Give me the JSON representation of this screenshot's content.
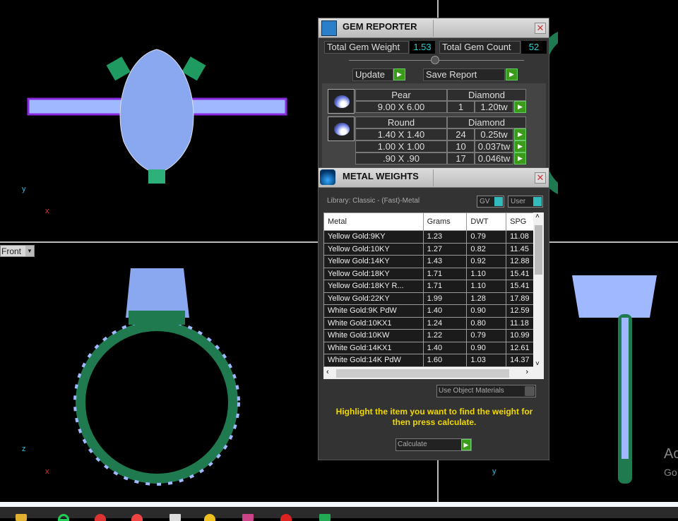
{
  "viewports": {
    "front_label": "Front",
    "axes": {
      "top_left": [
        "y",
        "x"
      ],
      "bottom_left": [
        "z",
        "x"
      ],
      "bottom_right": [
        "y"
      ]
    }
  },
  "gem_reporter": {
    "title": "GEM REPORTER",
    "total_weight_label": "Total Gem Weight",
    "total_weight": "1.53",
    "total_count_label": "Total Gem Count",
    "total_count": "52",
    "update_label": "Update",
    "save_label": "Save Report",
    "groups": [
      {
        "shape": "Pear",
        "material": "Diamond",
        "rows": [
          {
            "size": "9.00 X 6.00",
            "count": "1",
            "weight": "1.20tw"
          }
        ]
      },
      {
        "shape": "Round",
        "material": "Diamond",
        "rows": [
          {
            "size": "1.40 X 1.40",
            "count": "24",
            "weight": "0.25tw"
          },
          {
            "size": "1.00 X 1.00",
            "count": "10",
            "weight": "0.037tw"
          },
          {
            "size": ".90 X .90",
            "count": "17",
            "weight": "0.046tw"
          }
        ]
      }
    ]
  },
  "metal_weights": {
    "title": "METAL WEIGHTS",
    "library": "Library: Classic - (Fast)-Metal",
    "gv_label": "GV",
    "user_label": "User",
    "columns": [
      "Metal",
      "Grams",
      "DWT",
      "SPG"
    ],
    "rows": [
      [
        "Yellow Gold:9KY",
        "1.23",
        "0.79",
        "11.08"
      ],
      [
        "Yellow Gold:10KY",
        "1.27",
        "0.82",
        "11.45"
      ],
      [
        "Yellow Gold:14KY",
        "1.43",
        "0.92",
        "12.88"
      ],
      [
        "Yellow Gold:18KY",
        "1.71",
        "1.10",
        "15.41"
      ],
      [
        "Yellow Gold:18KY R...",
        "1.71",
        "1.10",
        "15.41"
      ],
      [
        "Yellow Gold:22KY",
        "1.99",
        "1.28",
        "17.89"
      ],
      [
        "White Gold:9K PdW",
        "1.40",
        "0.90",
        "12.59"
      ],
      [
        "White Gold:10KX1",
        "1.24",
        "0.80",
        "11.18"
      ],
      [
        "White Gold:10KW",
        "1.22",
        "0.79",
        "10.99"
      ],
      [
        "White Gold:14KX1",
        "1.40",
        "0.90",
        "12.61"
      ],
      [
        "White Gold:14K PdW",
        "1.60",
        "1.03",
        "14.37"
      ]
    ],
    "use_object_materials": "Use Object Materials",
    "hint": "Highlight the item you want to find the weight for then press calculate.",
    "calculate_label": "Calculate"
  },
  "watermark": {
    "line1": "Ac",
    "line2": "Go"
  },
  "colors": {
    "metal": "#1f7a4f",
    "gem": "#9fb8ff",
    "prong": "#8a2be2"
  }
}
